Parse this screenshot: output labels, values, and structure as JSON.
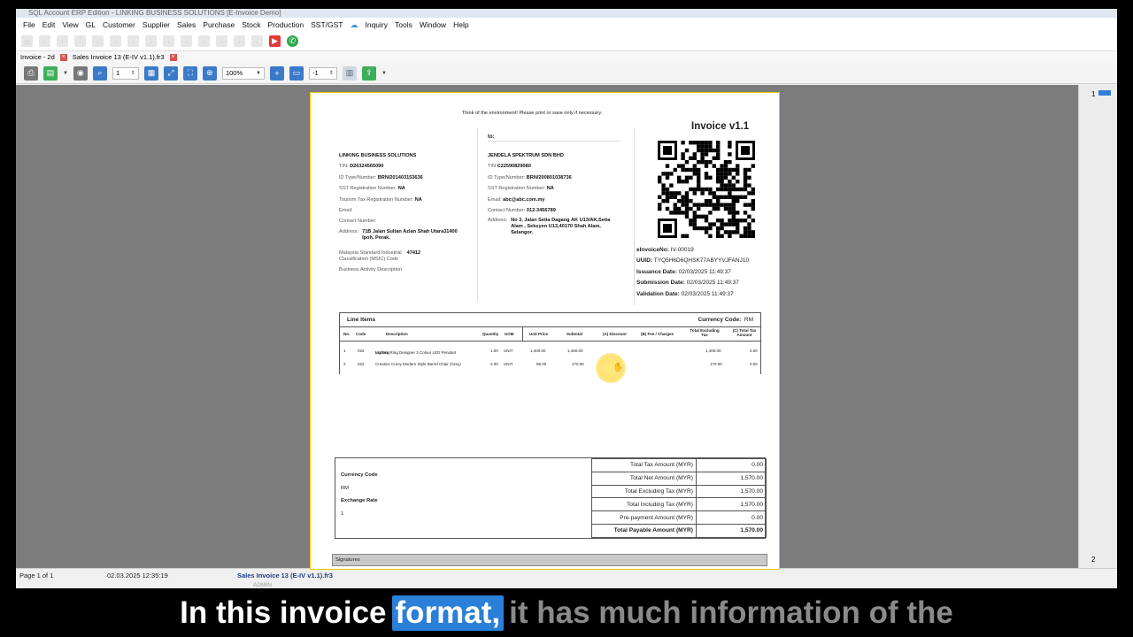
{
  "window": {
    "title": "SQL Account ERP Edition - LINKING BUSINESS SOLUTIONS [E-Invoice Demo]"
  },
  "menu": [
    "File",
    "Edit",
    "View",
    "GL",
    "Customer",
    "Supplier",
    "Sales",
    "Purchase",
    "Stock",
    "Production",
    "SST/GST",
    "Inquiry",
    "Tools",
    "Window",
    "Help"
  ],
  "tabs": [
    {
      "label": "Invoice - 2d"
    },
    {
      "label": "Sales Invoice 13 (E-IV v1.1).fr3"
    }
  ],
  "preview_toolbar": {
    "page_field": "1",
    "zoom": "100%",
    "scale_field": "-1"
  },
  "thumbs": {
    "page1": "1",
    "page2": "2"
  },
  "invoice": {
    "think_text": "Think of the environment! Please print or save only if necessary.",
    "title": "Invoice v1.1",
    "supplier": {
      "name": "LINKING BUSINESS SOLUTIONS",
      "tin_label": "TIN:",
      "tin": "D26324565090",
      "id_label": "ID Type/Number:",
      "id": "BRN/201403153636",
      "sst_label": "SST Registration Number:",
      "sst": "NA",
      "tourism_label": "Tourism Tax Registration Number:",
      "tourism": "NA",
      "email_label": "Email:",
      "contact_label": "Contact Number:",
      "address_label": "Address:",
      "address1": "71B Jalan Sultan Azlan Shah Utara31400",
      "address2": "Ipoh, Perak.",
      "msic_label1": "Malaysia Standard Industrial",
      "msic_label2": "Classification (MSIC) Code",
      "msic": "47412",
      "activity_label": "Business Activity Description"
    },
    "buyer": {
      "to_label": "to:",
      "name": "JENDELA SPEKTRUM SDN BHD",
      "tin_label": "TIN:",
      "tin": "C22590829080",
      "id_label": "ID Type/Number:",
      "id": "BRN/200801038736",
      "sst_label": "SST Registration Number:",
      "sst": "NA",
      "email_label": "Email:",
      "email": "abc@abc.com.my",
      "contact_label": "Contact Number:",
      "contact": "012-3456789",
      "address_label": "Address:",
      "address1": "No 3, Jalan Setia Dagang AK U13/AK,Setia",
      "address2": "Alam , Seksyen U13,40170 Shah Alam,",
      "address3": "Selangor."
    },
    "einvoice": {
      "no_label": "eInvoiceNo:",
      "no": "IV-00019",
      "uuid_label": "UUID:",
      "uuid": "TYQ5H6D6QHSK77ABYYVJFANJ10",
      "issuance_label": "Issuance Date:",
      "issuance": "02/03/2025 11:49:37",
      "submission_label": "Submission Date:",
      "submission": "02/03/2025 11:49:37",
      "validation_label": "Validation Date:",
      "validation": "02/03/2025 11:49:37"
    },
    "line_items": {
      "title": "Line Items",
      "currency_label": "Currency Code:",
      "currency": "RM",
      "columns": [
        "No.",
        "Code",
        "Description",
        "Quantity",
        "UOM",
        "Unit Price",
        "Subtotal",
        "(A) Discount",
        "(B) Fee / Charges",
        "Total Excluding Tax",
        "(C) Total Tax Amount"
      ],
      "rows": [
        {
          "no": "1",
          "code": "022",
          "desc1": "Modern Ring Designer 3 Colour LED Pendant",
          "desc2": "Lighting",
          "qty": "1.00",
          "uom": "UNIT",
          "price": "1,400.00",
          "subtotal": "1,400.00",
          "excl": "1,400.00",
          "tax": "0.00"
        },
        {
          "no": "2",
          "code": "022",
          "desc1": "Creative Curvy Modern Style Barrel Chair (Grey)",
          "desc2": "",
          "qty": "2.00",
          "uom": "UNIT",
          "price": "85.00",
          "subtotal": "170.00",
          "excl": "170.00",
          "tax": "0.00"
        }
      ]
    },
    "summary": {
      "currency_label": "Currency Code",
      "currency": "RM",
      "rate_label": "Exchange Rate",
      "rate": "1",
      "rows": [
        {
          "label": "Total Tax Amount (MYR)",
          "value": "0.00"
        },
        {
          "label": "Total Net Amount (MYR)",
          "value": "1,570.00"
        },
        {
          "label": "Total Excluding Tax (MYR)",
          "value": "1,570.00"
        },
        {
          "label": "Total Including Tax (MYR)",
          "value": "1,570.00"
        },
        {
          "label": "Pre-payment Amount (MYR)",
          "value": "0.00"
        },
        {
          "label": "Total Payable Amount (MYR)",
          "value": "1,570.00"
        }
      ]
    },
    "signatures_label": "Signatures"
  },
  "status": {
    "page": "Page 1 of 1",
    "datetime": "02.03.2025 12:35:19",
    "file": "Sales Invoice 13 (E-IV v1.1).fr3",
    "user": "ADMIN"
  },
  "subtitle": {
    "part1": "In this invoice",
    "highlight": "format,",
    "part2": "it has much information of the"
  },
  "colors": {
    "accent": "#2a7fd9",
    "page_border": "#e6c800",
    "workspace": "#7c7c7c"
  }
}
